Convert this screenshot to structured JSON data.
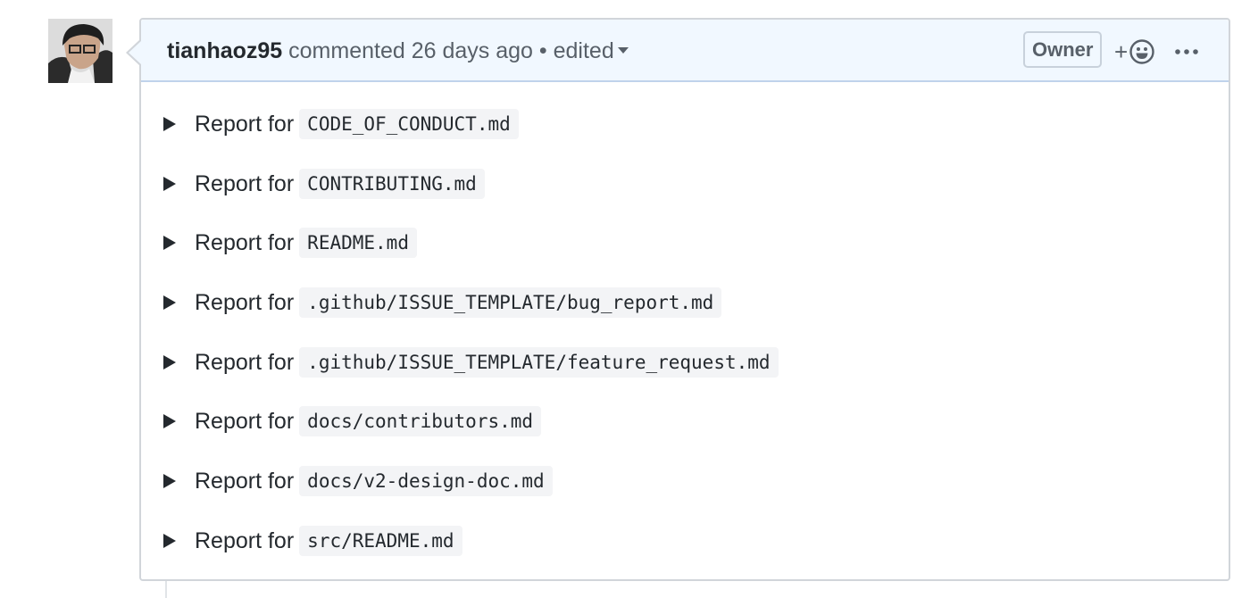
{
  "comment": {
    "author": "tianhaoz95",
    "action": "commented",
    "time": "26 days ago",
    "separator": "•",
    "edited_label": "edited",
    "owner_badge": "Owner",
    "reaction_plus": "+",
    "more_icon": "kebab-horizontal-icon",
    "reaction_icon": "smiley-icon"
  },
  "reports": [
    {
      "label": "Report for",
      "file": "CODE_OF_CONDUCT.md"
    },
    {
      "label": "Report for",
      "file": "CONTRIBUTING.md"
    },
    {
      "label": "Report for",
      "file": "README.md"
    },
    {
      "label": "Report for",
      "file": ".github/ISSUE_TEMPLATE/bug_report.md"
    },
    {
      "label": "Report for",
      "file": ".github/ISSUE_TEMPLATE/feature_request.md"
    },
    {
      "label": "Report for",
      "file": "docs/contributors.md"
    },
    {
      "label": "Report for",
      "file": "docs/v2-design-doc.md"
    },
    {
      "label": "Report for",
      "file": "src/README.md"
    }
  ],
  "colors": {
    "header_bg": "#f1f8ff",
    "border": "#d1d5da",
    "code_bg": "#f3f4f6",
    "text": "#24292e",
    "muted": "#586069"
  }
}
